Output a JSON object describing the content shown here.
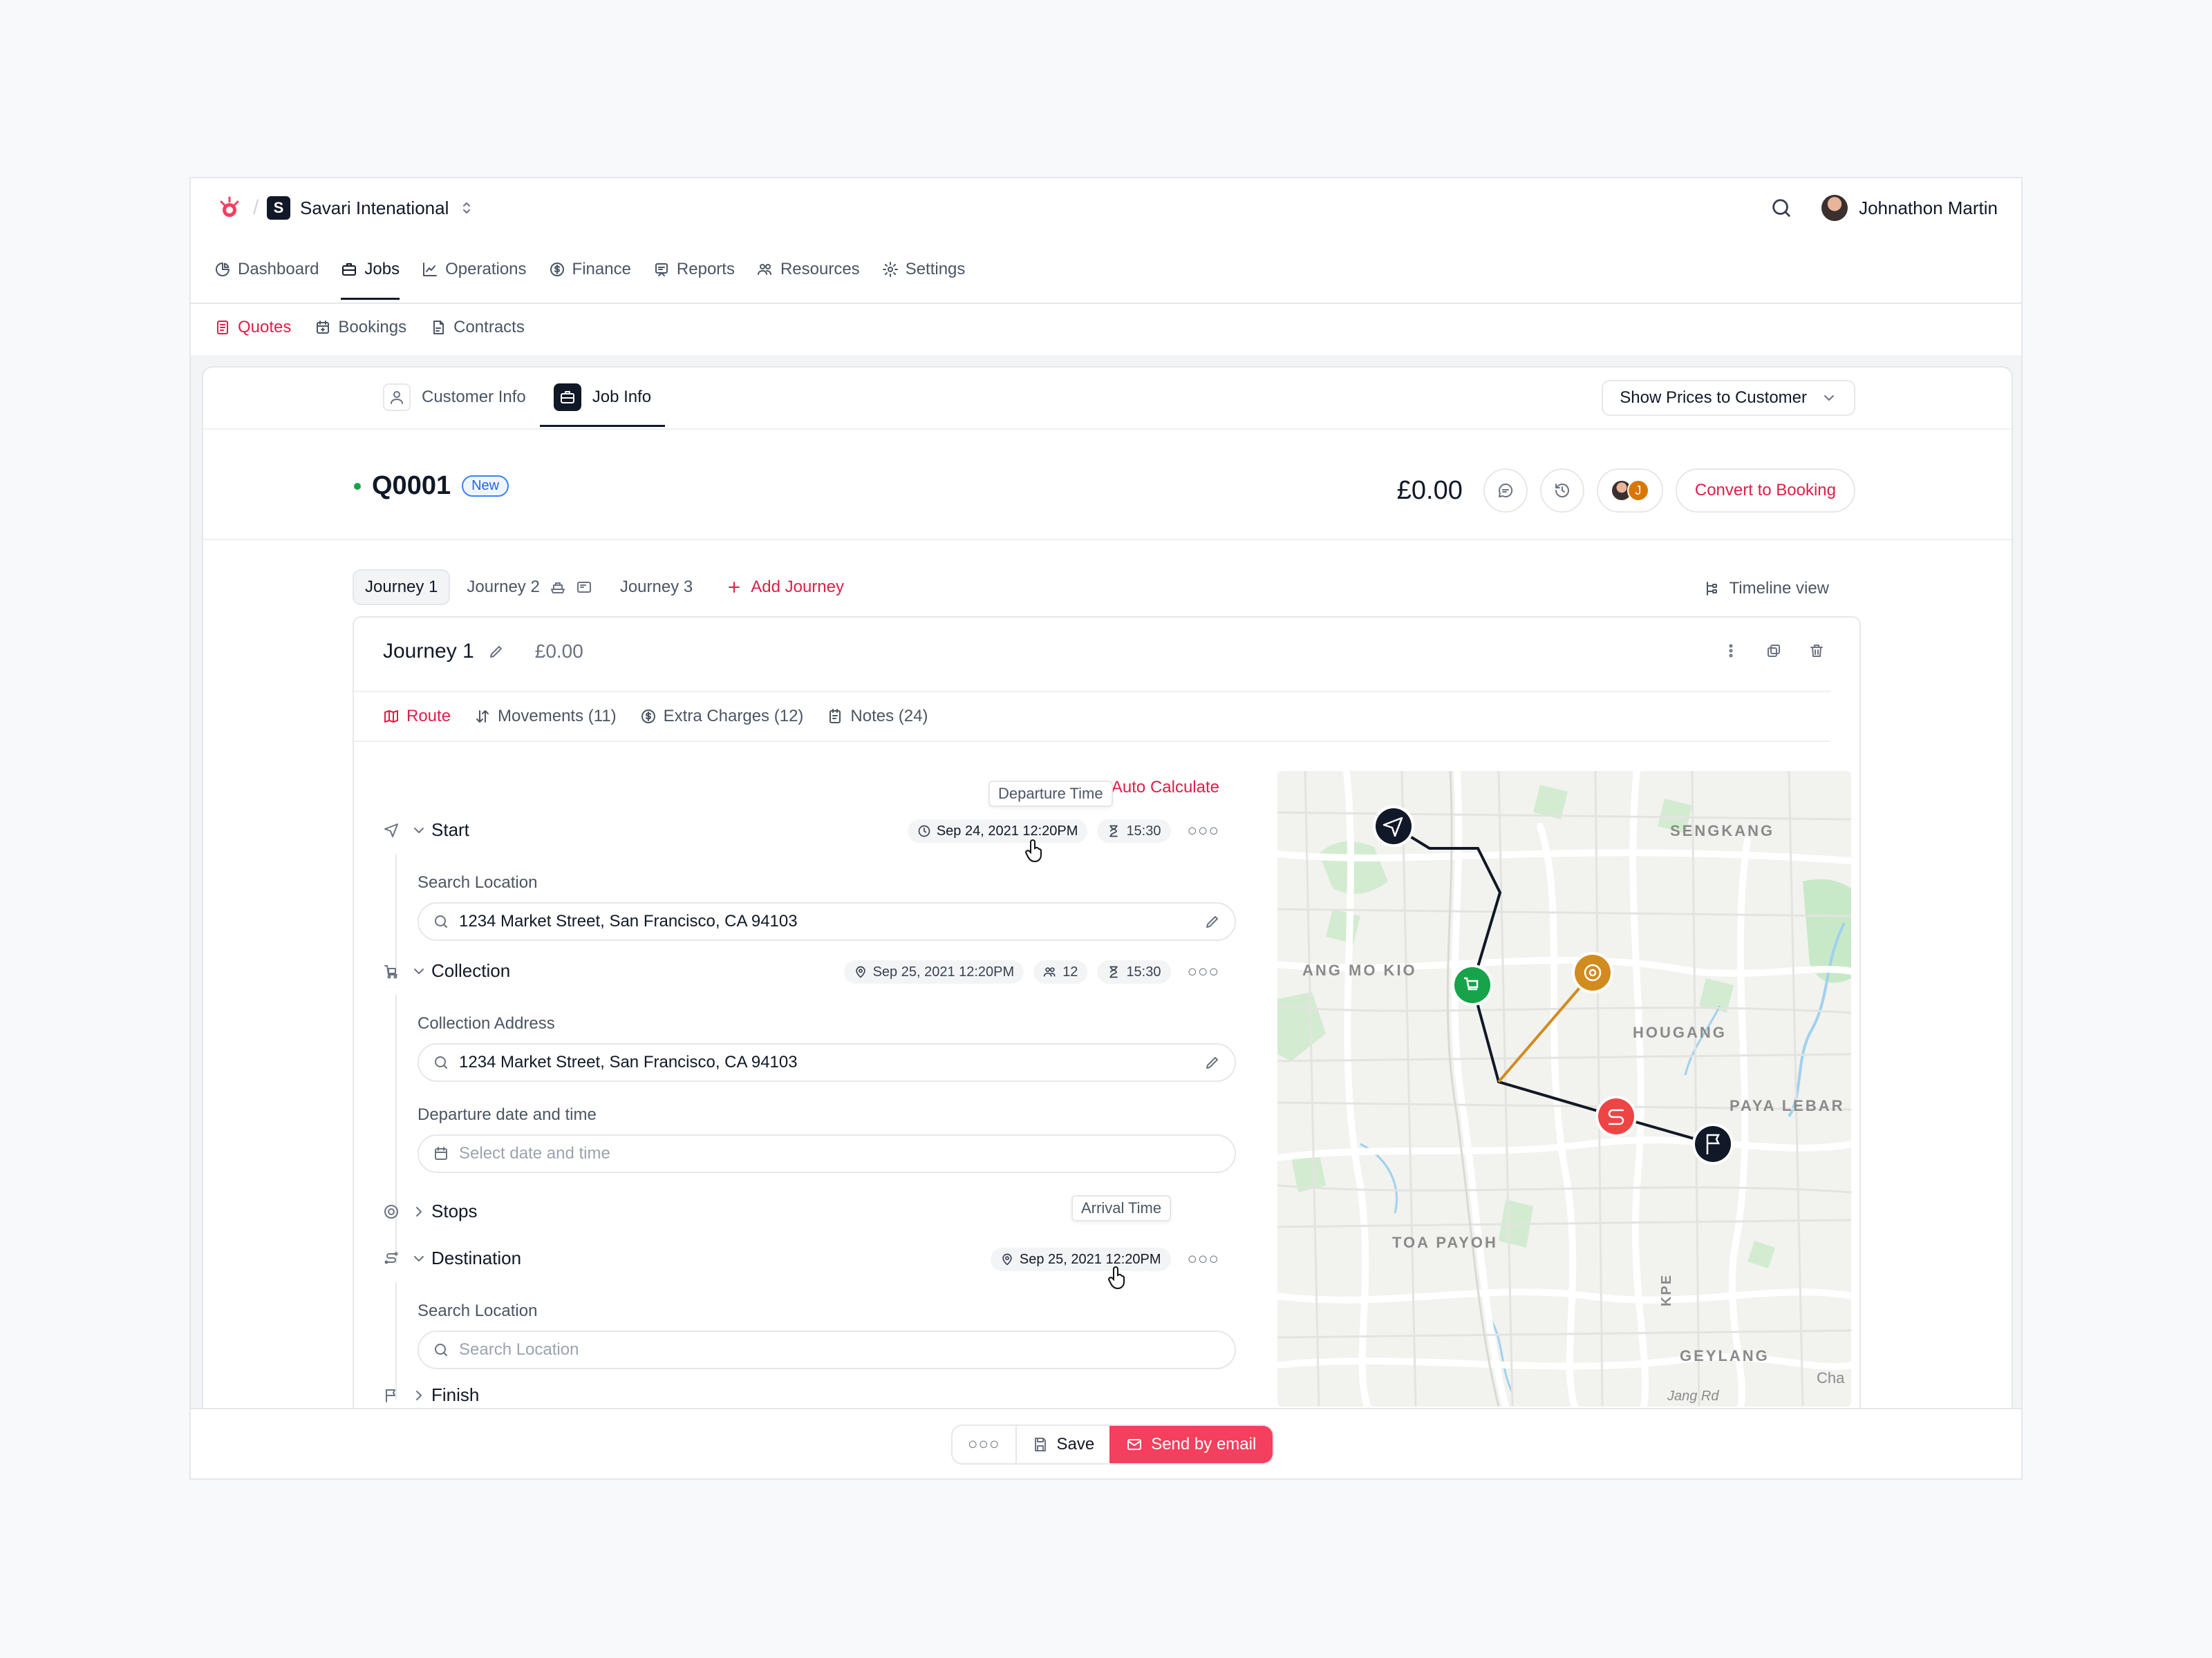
{
  "org": {
    "name": "Savari Intenational",
    "initial": "S"
  },
  "user": {
    "name": "Johnathon Martin"
  },
  "main_nav": [
    "Dashboard",
    "Jobs",
    "Operations",
    "Finance",
    "Reports",
    "Resources",
    "Settings"
  ],
  "sub_nav": [
    "Quotes",
    "Bookings",
    "Contracts"
  ],
  "tabs": {
    "customer_info": "Customer Info",
    "job_info": "Job Info"
  },
  "show_prices": "Show Prices to Customer",
  "quote": {
    "id": "Q0001",
    "status": "New",
    "total": "£0.00",
    "avatar_initial": "J",
    "convert_label": "Convert to Booking"
  },
  "journeys": {
    "items": [
      "Journey 1",
      "Journey 2",
      "Journey 3"
    ],
    "add_label": "Add Journey",
    "timeline_label": "Timeline view"
  },
  "journey_panel": {
    "title": "Journey 1",
    "price": "£0.00"
  },
  "journey_tabs": [
    "Route",
    "Movements (11)",
    "Extra Charges (12)",
    "Notes (24)"
  ],
  "route": {
    "auto_calc": "Auto Calculate",
    "start": {
      "label": "Start",
      "tooltip": "Departure Time",
      "date": "Sep 24, 2021 12:20PM",
      "duration": "15:30",
      "field_label": "Search Location",
      "value": "1234 Market Street, San Francisco, CA 94103"
    },
    "collection": {
      "label": "Collection",
      "date": "Sep 25, 2021 12:20PM",
      "passengers": "12",
      "duration": "15:30",
      "field_label": "Collection Address",
      "value": "1234 Market Street, San Francisco, CA 94103",
      "departure_label": "Departure date and time",
      "departure_placeholder": "Select date and time"
    },
    "stops": {
      "label": "Stops"
    },
    "destination": {
      "label": "Destination",
      "tooltip": "Arrival Time",
      "date": "Sep 25, 2021 12:20PM",
      "field_label": "Search Location",
      "placeholder": "Search Location"
    },
    "finish": {
      "label": "Finish"
    }
  },
  "map": {
    "labels": [
      "SENGKANG",
      "ANG MO KIO",
      "HOUGANG",
      "PAYA LEBAR",
      "TOA PAYOH",
      "GEYLANG",
      "KPE",
      "Cha",
      "Jang Rd"
    ]
  },
  "footer": {
    "save": "Save",
    "send": "Send by email"
  },
  "colors": {
    "accent": "#e11d48",
    "primary_button": "#f43f5e",
    "dark": "#111827",
    "green_pin": "#16a34a",
    "orange_pin": "#d18b1f",
    "red_pin": "#ef4444"
  }
}
